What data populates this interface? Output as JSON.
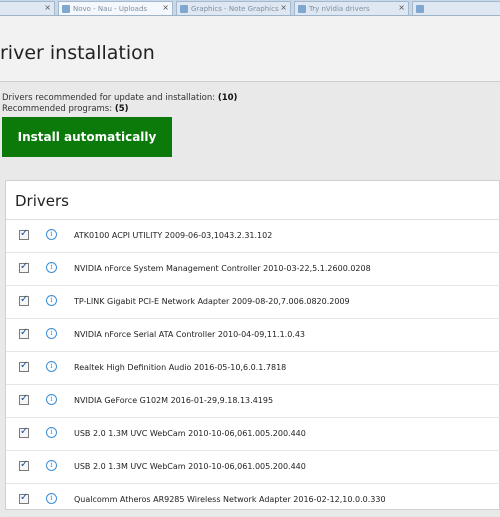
{
  "browser": {
    "tabs": [
      {
        "label": "Novo - Nau - Uploads"
      },
      {
        "label": "Graphics - Note Graphics"
      },
      {
        "label": "Try nVidia drivers"
      },
      {
        "label": ""
      }
    ]
  },
  "header": {
    "title": "river installation"
  },
  "summary": {
    "update_label": "Drivers recommended for update and installation:",
    "update_count": "(10)",
    "programs_label": "Recommended programs:",
    "programs_count": "(5)"
  },
  "install_button": {
    "label": "Install automatically",
    "color": "#0b7a0b"
  },
  "drivers_panel": {
    "title": "Drivers",
    "items": [
      {
        "name": "ATK0100 ACPI UTILITY 2009-06-03,1043.2.31.102",
        "checked": true
      },
      {
        "name": "NVIDIA nForce System Management Controller 2010-03-22,5.1.2600.0208",
        "checked": true
      },
      {
        "name": "TP-LINK Gigabit PCI-E Network Adapter 2009-08-20,7.006.0820.2009",
        "checked": true
      },
      {
        "name": "NVIDIA nForce Serial ATA Controller 2010-04-09,11.1.0.43",
        "checked": true
      },
      {
        "name": "Realtek High Definition Audio 2016-05-10,6.0.1.7818",
        "checked": true
      },
      {
        "name": "NVIDIA GeForce G102M 2016-01-29,9.18.13.4195",
        "checked": true
      },
      {
        "name": "USB 2.0 1.3M UVC WebCam 2010-10-06,061.005.200.440",
        "checked": true
      },
      {
        "name": "USB 2.0 1.3M UVC WebCam 2010-10-06,061.005.200.440",
        "checked": true
      },
      {
        "name": "Qualcomm Atheros AR9285 Wireless Network Adapter 2016-02-12,10.0.0.330",
        "checked": true
      }
    ]
  }
}
